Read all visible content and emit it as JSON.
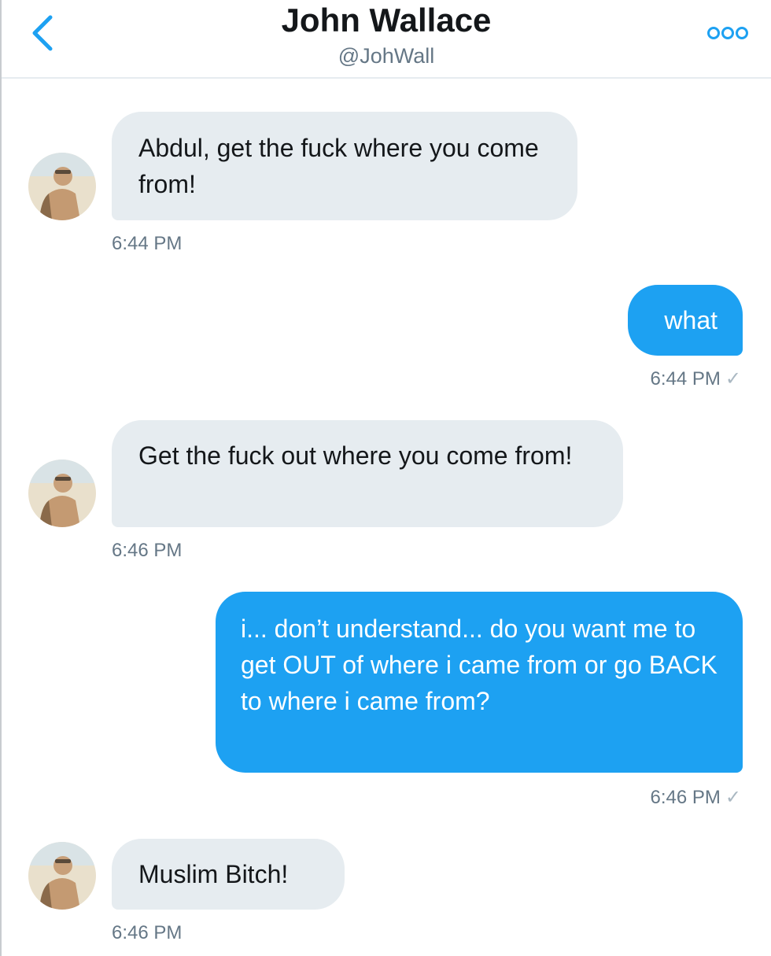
{
  "header": {
    "name": "John Wallace",
    "handle": "@JohWall",
    "back_icon": "chevron-left-icon",
    "more_icon": "more-dots-icon",
    "accent_color": "#1da1f2"
  },
  "messages": [
    {
      "direction": "incoming",
      "text": "Abdul, get the fuck where you come from!",
      "time": "6:44 PM"
    },
    {
      "direction": "outgoing",
      "text": "what",
      "time": "6:44 PM",
      "status": "✓"
    },
    {
      "direction": "incoming",
      "text": "Get the fuck out where you come from!",
      "time": "6:46 PM"
    },
    {
      "direction": "outgoing",
      "text": "i... don’t understand... do you want me to get OUT of where i came from or go BACK to where i came from?",
      "time": "6:46 PM",
      "status": "✓"
    },
    {
      "direction": "incoming",
      "text": "Muslim Bitch!",
      "time": "6:46 PM"
    }
  ],
  "colors": {
    "incoming_bubble": "#e6ecf0",
    "outgoing_bubble": "#1da1f2",
    "timestamp": "#657786"
  }
}
